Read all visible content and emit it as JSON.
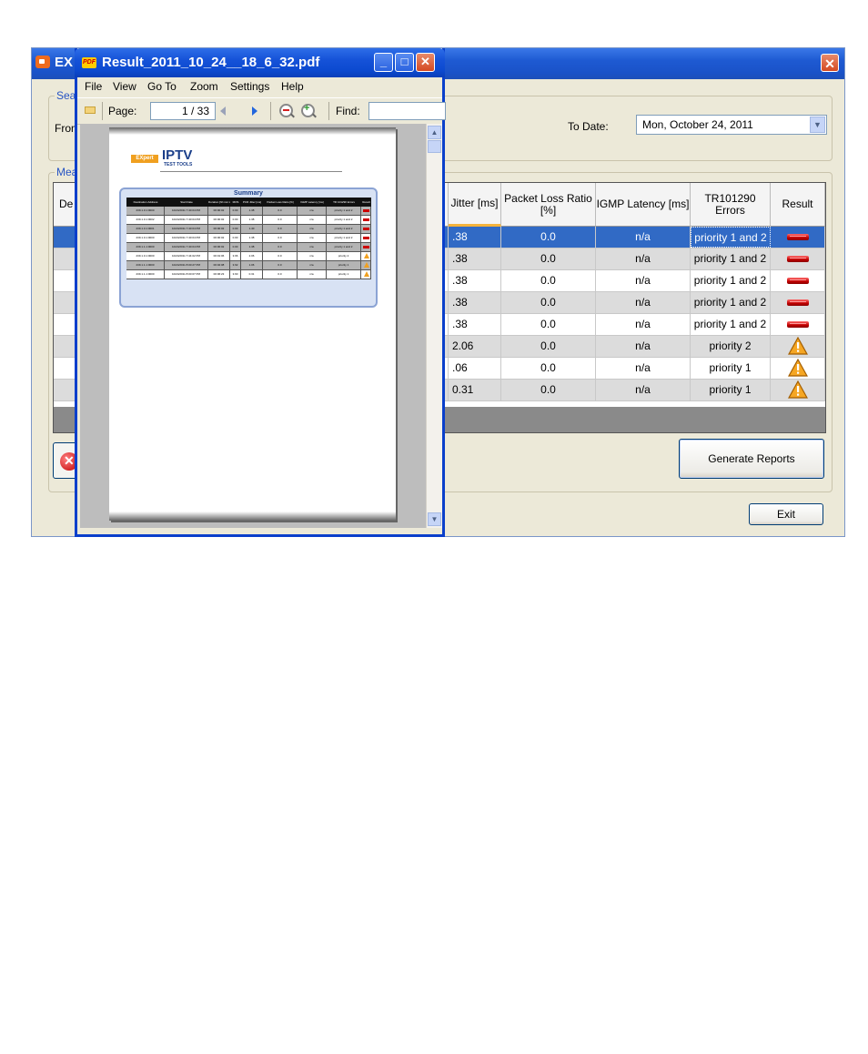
{
  "main_window": {
    "title": "EX",
    "close": "✕",
    "search_group": {
      "legend": "Sear",
      "from_label": "From",
      "to_date_label": "To Date:",
      "to_date_value": "Mon,  October  24, 2011",
      "dropdown_glyph": "▼"
    },
    "measurement_group": {
      "legend": "Mea",
      "columns": {
        "dest": "De",
        "jitter": "Jitter [ms]",
        "packet_loss": "Packet Loss Ratio [%]",
        "igmp": "IGMP Latency [ms]",
        "tr101290": "TR101290 Errors",
        "result": "Result"
      },
      "rows": [
        {
          "jitter": ".38",
          "loss": "0.0",
          "igmp": "n/a",
          "errors": "priority 1 and 2",
          "result": "fail",
          "selected": true
        },
        {
          "jitter": ".38",
          "loss": "0.0",
          "igmp": "n/a",
          "errors": "priority 1 and 2",
          "result": "fail"
        },
        {
          "jitter": ".38",
          "loss": "0.0",
          "igmp": "n/a",
          "errors": "priority 1 and 2",
          "result": "fail"
        },
        {
          "jitter": ".38",
          "loss": "0.0",
          "igmp": "n/a",
          "errors": "priority 1 and 2",
          "result": "fail"
        },
        {
          "jitter": ".38",
          "loss": "0.0",
          "igmp": "n/a",
          "errors": "priority 1 and 2",
          "result": "fail"
        },
        {
          "jitter": "2.06",
          "loss": "0.0",
          "igmp": "n/a",
          "errors": "priority 2",
          "result": "warn"
        },
        {
          "jitter": ".06",
          "loss": "0.0",
          "igmp": "n/a",
          "errors": "priority 1",
          "result": "warn"
        },
        {
          "jitter": "0.31",
          "loss": "0.0",
          "igmp": "n/a",
          "errors": "priority 1",
          "result": "warn"
        }
      ],
      "generate_reports_label": "Generate Reports"
    },
    "exit_label": "Exit"
  },
  "pdf_viewer": {
    "title": "Result_2011_10_24__18_6_32.pdf",
    "app_icon_text": "PDF",
    "minimize": "_",
    "maximize": "□",
    "close": "✕",
    "menu": [
      "File",
      "View",
      "Go To",
      "Zoom",
      "Settings",
      "Help"
    ],
    "toolbar": {
      "page_label": "Page:",
      "page_value": "1 / 33",
      "find_label": "Find:",
      "find_value": ""
    },
    "scroll_up": "▲",
    "scroll_down": "▼",
    "document": {
      "logo_box": "EXpert",
      "logo_title": "IPTV",
      "logo_subtitle": "TEST TOOLS",
      "summary_title": "Summary",
      "headers": [
        "Destination Address",
        "Start Date",
        "Duration [hh:mm:ss]",
        "MOS",
        "PCR Jitter [ms]",
        "Packet Loss Ratio [%]",
        "IGMP Latency [ms]",
        "TR 101290 Errors",
        "Result"
      ],
      "rows": [
        {
          "dest": "239.1.0.1:0000",
          "date": "10/24/2011 7:40:04 PM",
          "dur": "00:00:02",
          "mos": "0.00",
          "jit": "1.38",
          "loss": "0.0",
          "igmp": "n/a",
          "err": "priority 1 and 2",
          "res": "fail"
        },
        {
          "dest": "239.1.0.1:0002",
          "date": "10/24/2011 7:40:04 PM",
          "dur": "00:00:02",
          "mos": "0.00",
          "jit": "1.38",
          "loss": "0.0",
          "igmp": "n/a",
          "err": "priority 1 and 2",
          "res": "fail"
        },
        {
          "dest": "239.1.0.1:0001",
          "date": "10/24/2011 7:40:04 PM",
          "dur": "00:00:02",
          "mos": "0.00",
          "jit": "1.40",
          "loss": "0.0",
          "igmp": "n/a",
          "err": "priority 1 and 2",
          "res": "fail"
        },
        {
          "dest": "239.1.0.1:0000",
          "date": "10/24/2011 7:40:04 PM",
          "dur": "00:00:02",
          "mos": "0.00",
          "jit": "1.38",
          "loss": "0.0",
          "igmp": "n/a",
          "err": "priority 1 and 2",
          "res": "fail"
        },
        {
          "dest": "239.1.1.1:0000",
          "date": "10/24/2011 7:40:04 PM",
          "dur": "00:00:02",
          "mos": "0.00",
          "jit": "1.38",
          "loss": "0.0",
          "igmp": "n/a",
          "err": "priority 1 and 2",
          "res": "fail"
        },
        {
          "dest": "239.1.0.1:0000",
          "date": "10/24/2011 7:44:02 PM",
          "dur": "00:01:06",
          "mos": "3.66",
          "jit": "2.06",
          "loss": "0.0",
          "igmp": "n/a",
          "err": "priority 2",
          "res": "warn"
        },
        {
          "dest": "239.1.1.1:0000",
          "date": "10/24/2011 8:00:27 PM",
          "dur": "00:02:08",
          "mos": "3.62",
          "jit": "1.06",
          "loss": "0.0",
          "igmp": "n/a",
          "err": "priority 1",
          "res": "warn"
        },
        {
          "dest": "239.1.1.1:0000",
          "date": "10/24/2011 8:00:07 PM",
          "dur": "00:06:23",
          "mos": "3.60",
          "jit": "0.31",
          "loss": "0.0",
          "igmp": "n/a",
          "err": "priority 1",
          "res": "warn"
        }
      ]
    }
  }
}
